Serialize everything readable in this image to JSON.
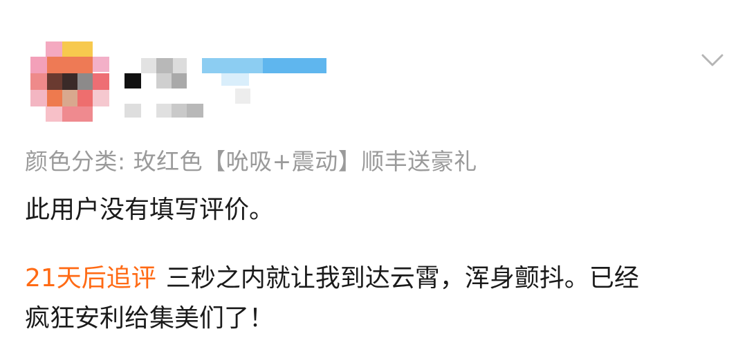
{
  "review": {
    "variant_label": "颜色分类: 玫红色【吮吸+震动】顺丰送豪礼",
    "text": "此用户没有填写评价。",
    "followup_tag": "21天后追评",
    "followup_line1": "三秒之内就让我到达云霄，浑身颤抖。已经",
    "followup_line2": "疯狂安利给集美们了！"
  },
  "icons": {
    "expand": "chevron-down-icon"
  },
  "colors": {
    "accent": "#ff6a14",
    "muted_text": "#9a9a9a",
    "body_text": "#1a1a1a"
  }
}
